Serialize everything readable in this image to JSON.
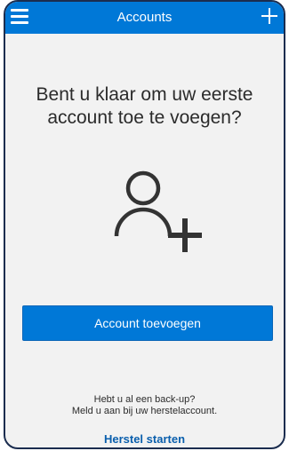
{
  "header": {
    "title": "Accounts",
    "menu_icon": "hamburger-menu-icon",
    "add_icon": "plus-icon"
  },
  "main": {
    "heading_line1": "Bent u klaar om uw eerste",
    "heading_line2": "account toe te voegen?",
    "illustration_icon": "add-person-icon",
    "add_account_button": "Account toevoegen",
    "backup_question": "Hebt u al een back-up?",
    "backup_hint": "Meld u aan bij uw herstelaccount.",
    "restore_link": "Herstel starten"
  },
  "colors": {
    "accent": "#0078d7",
    "background": "#f2f2f2",
    "text": "#2b2b2b",
    "link": "#0a5fad"
  }
}
